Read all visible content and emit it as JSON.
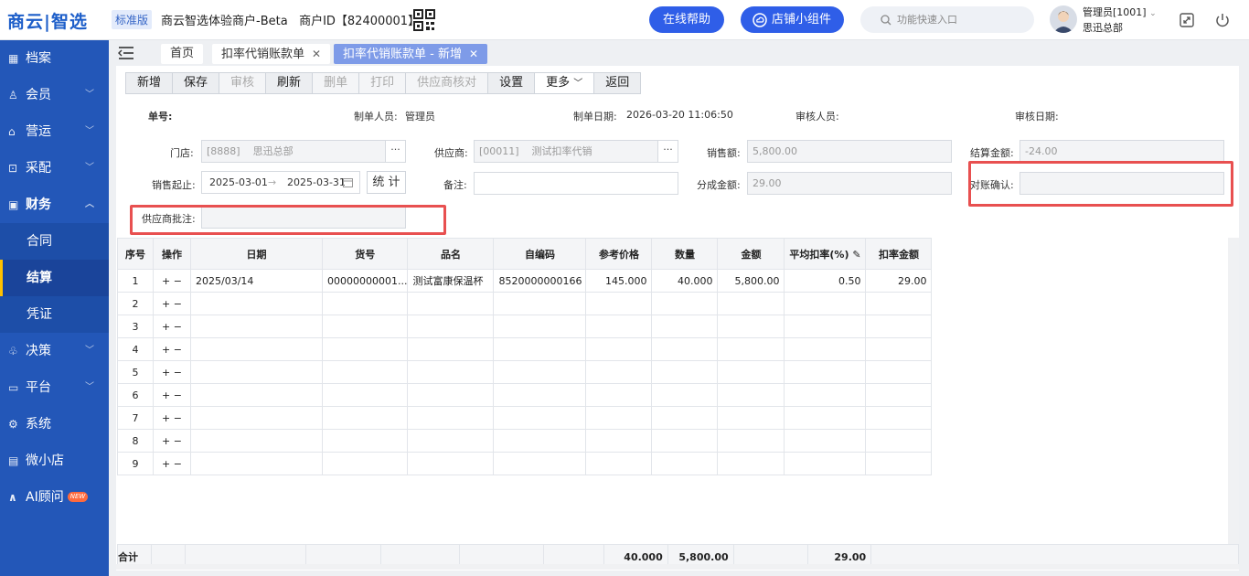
{
  "topbar": {
    "logo": "商云|智选",
    "edition": "标准版",
    "merchant": "商云智选体验商户-Beta   商户ID【82400001】",
    "help_button": "在线帮助",
    "widget_button": "店铺小组件",
    "search_placeholder": "功能快速入口",
    "user_name": "管理员[1001]",
    "user_org": "思迅总部"
  },
  "sidebar": {
    "items": [
      {
        "label": "档案",
        "icon": "archive-icon",
        "chevron": false
      },
      {
        "label": "会员",
        "icon": "user-icon",
        "chevron": true
      },
      {
        "label": "营运",
        "icon": "store-icon",
        "chevron": true
      },
      {
        "label": "采配",
        "icon": "cart-icon",
        "chevron": true
      },
      {
        "label": "财务",
        "icon": "finance-icon",
        "chevron": true,
        "expanded": true
      },
      {
        "label": "决策",
        "icon": "decision-icon",
        "chevron": true
      },
      {
        "label": "平台",
        "icon": "platform-icon",
        "chevron": true
      },
      {
        "label": "系统",
        "icon": "gear-icon",
        "chevron": false
      },
      {
        "label": "微小店",
        "icon": "shop-icon",
        "chevron": false
      },
      {
        "label": "AI顾问",
        "icon": "ai-icon",
        "chevron": false,
        "badge": "NEW"
      }
    ],
    "finance_sub": [
      "合同",
      "结算",
      "凭证"
    ],
    "active_sub": "结算"
  },
  "tabs": [
    {
      "label": "首页",
      "closable": false
    },
    {
      "label": "扣率代销账款单",
      "closable": true
    },
    {
      "label": "扣率代销账款单 - 新增",
      "closable": true,
      "active": true
    }
  ],
  "toolbar": [
    "新增",
    "保存",
    "审核",
    "刷新",
    "删单",
    "打印",
    "供应商核对",
    "设置",
    "更多",
    "返回"
  ],
  "toolbar_disabled": [
    "审核",
    "删单",
    "打印",
    "供应商核对"
  ],
  "header": {
    "doc_no_label": "单号:",
    "creator_label": "制单人员:",
    "creator": "管理员",
    "date_label": "制单日期:",
    "date": "2026-03-20 11:06:50",
    "reviewer_label": "审核人员:",
    "review_date_label": "审核日期:"
  },
  "form": {
    "store_label": "门店:",
    "store_value": "[8888]    思迅总部",
    "supplier_label": "供应商:",
    "supplier_value": "[00011]    测试扣率代销",
    "sales_label": "销售额:",
    "sales_value": "5,800.00",
    "settle_label": "结算金额:",
    "settle_value": "-24.00",
    "period_label": "销售起止:",
    "period_start": "2025-03-01",
    "period_end": "2025-03-31",
    "stat_button": "统 计",
    "remark_label": "备注:",
    "share_label": "分成金额:",
    "share_value": "29.00",
    "confirm_label": "对账确认:",
    "supplier_note_label": "供应商批注:"
  },
  "table": {
    "columns": [
      "序号",
      "操作",
      "日期",
      "货号",
      "品名",
      "自编码",
      "参考价格",
      "数量",
      "金额",
      "平均扣率(%)",
      "扣率金额"
    ],
    "rows": [
      {
        "no": "1",
        "date": "2025/03/14",
        "sku": "00000000001...",
        "name": "测试富康保温杯",
        "code": "8520000000166",
        "price": "145.000",
        "qty": "40.000",
        "amount": "5,800.00",
        "rate": "0.50",
        "rate_amount": "29.00"
      },
      {
        "no": "2"
      },
      {
        "no": "3"
      },
      {
        "no": "4"
      },
      {
        "no": "5"
      },
      {
        "no": "6"
      },
      {
        "no": "7"
      },
      {
        "no": "8"
      },
      {
        "no": "9"
      }
    ],
    "op_add": "+",
    "op_remove": "−",
    "total_label": "合计",
    "total_qty": "40.000",
    "total_amount": "5,800.00",
    "total_rate_amount": "29.00"
  }
}
